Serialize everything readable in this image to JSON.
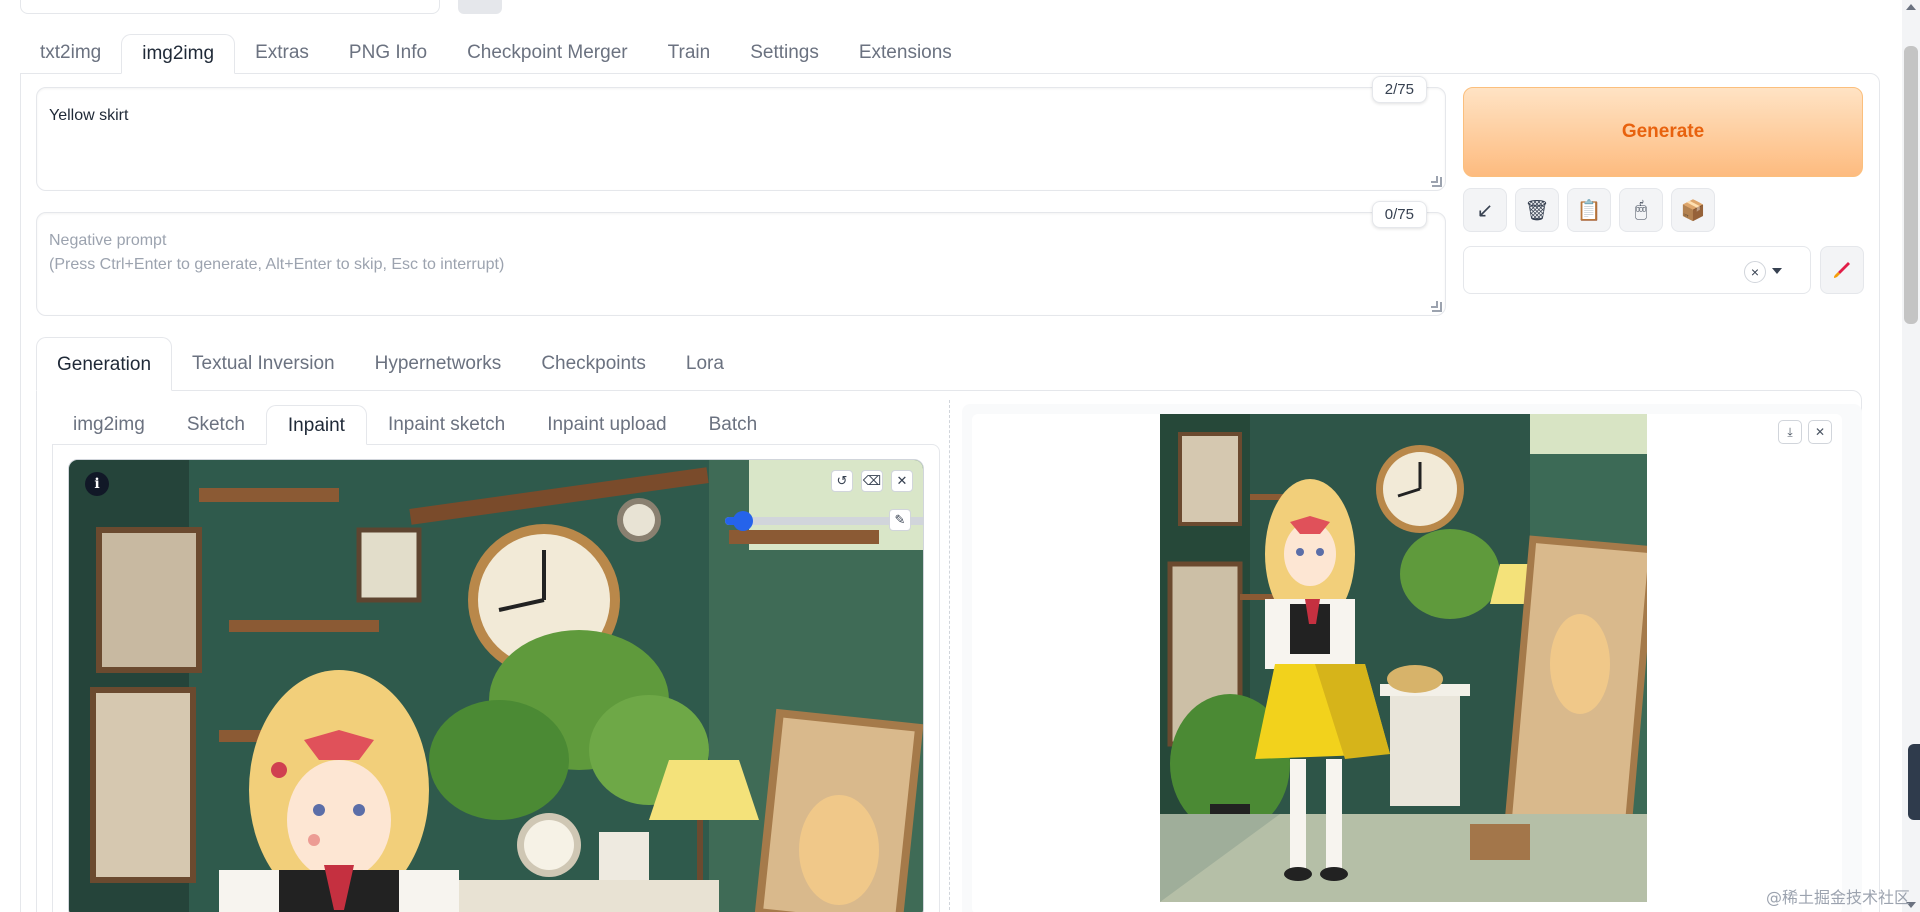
{
  "main_tabs": [
    "txt2img",
    "img2img",
    "Extras",
    "PNG Info",
    "Checkpoint Merger",
    "Train",
    "Settings",
    "Extensions"
  ],
  "main_tab_active": "img2img",
  "prompt": {
    "value": "Yellow skirt",
    "token_count": "2/75"
  },
  "negative_prompt": {
    "placeholder": "Negative prompt\n(Press Ctrl+Enter to generate, Alt+Enter to skip, Esc to interrupt)",
    "token_count": "0/75"
  },
  "generate": {
    "label": "Generate"
  },
  "tool_buttons": [
    "arrow-down-left-icon",
    "trash-icon",
    "clipboard-icon",
    "mouse-icon",
    "package-icon"
  ],
  "tool_symbols": [
    "↙",
    "🗑",
    "📋",
    "🖱",
    "📦"
  ],
  "styles": {
    "clear_symbol": "×"
  },
  "section_tabs": [
    "Generation",
    "Textual Inversion",
    "Hypernetworks",
    "Checkpoints",
    "Lora"
  ],
  "section_tab_active": "Generation",
  "img2img_tabs": [
    "img2img",
    "Sketch",
    "Inpaint",
    "Inpaint sketch",
    "Inpaint upload",
    "Batch"
  ],
  "img2img_tab_active": "Inpaint",
  "canvas": {
    "info_symbol": "i",
    "undo_symbol": "↺",
    "erase_symbol": "⌫",
    "close_symbol": "✕",
    "brush_symbol": "✎",
    "brush_size": 0.08
  },
  "gallery": {
    "download_symbol": "⤓",
    "close_symbol": "✕"
  },
  "watermark": "@稀土掘金技术社区",
  "colors": {
    "accent": "#e8620e",
    "slider": "#2563eb"
  }
}
